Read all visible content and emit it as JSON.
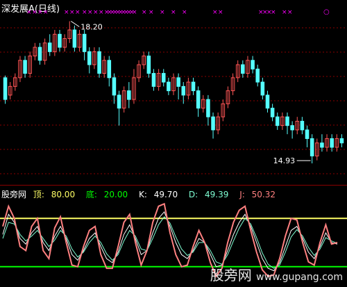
{
  "main": {
    "title": "深发展A(日线)",
    "high_label": "18.20",
    "low_label": "14.93",
    "colors": {
      "up": "#ff5555",
      "down": "#55ffff",
      "marker": "#ff00ff",
      "grid": "#8b0000"
    }
  },
  "indicator": {
    "name": "股旁网",
    "top_label": "顶:",
    "top_value": "80.00",
    "bottom_label": "底:",
    "bottom_value": "20.00",
    "k_label": "K:",
    "k_value": "49.70",
    "d_label": "D:",
    "d_value": "49.39",
    "j_label": "J:",
    "j_value": "50.32",
    "colors": {
      "top": "#ffff66",
      "bottom": "#00ff00",
      "k": "#ffffff",
      "d": "#7fffd4",
      "j": "#ff8080"
    }
  },
  "watermark": {
    "cn": "股旁网",
    "url": "www.gupang.com"
  },
  "chart_data": [
    {
      "type": "candlestick",
      "title": "深发展A(日线)",
      "ylim": [
        14.5,
        18.4
      ],
      "annotations": [
        {
          "text": "18.20",
          "value": 18.2
        },
        {
          "text": "14.93",
          "value": 14.93
        }
      ],
      "candles": [
        [
          16.9,
          16.4,
          16.95,
          16.3
        ],
        [
          16.5,
          16.7,
          16.8,
          16.4
        ],
        [
          16.7,
          16.9,
          17.0,
          16.6
        ],
        [
          16.9,
          17.3,
          17.4,
          16.8
        ],
        [
          17.3,
          17.0,
          17.4,
          16.9
        ],
        [
          17.0,
          17.4,
          17.5,
          16.9
        ],
        [
          17.4,
          17.6,
          17.7,
          17.3
        ],
        [
          17.6,
          17.3,
          17.7,
          17.2
        ],
        [
          17.3,
          17.7,
          17.8,
          17.2
        ],
        [
          17.7,
          17.5,
          17.9,
          17.4
        ],
        [
          17.5,
          17.9,
          18.0,
          17.4
        ],
        [
          17.9,
          17.6,
          18.0,
          17.5
        ],
        [
          17.6,
          17.8,
          17.9,
          17.5
        ],
        [
          17.8,
          18.0,
          18.2,
          17.7
        ],
        [
          18.0,
          17.6,
          18.1,
          17.5
        ],
        [
          17.6,
          17.9,
          18.0,
          17.5
        ],
        [
          17.9,
          17.5,
          18.0,
          17.3
        ],
        [
          17.5,
          17.2,
          17.6,
          17.0
        ],
        [
          17.2,
          17.5,
          17.6,
          17.1
        ],
        [
          17.5,
          17.0,
          17.6,
          16.9
        ],
        [
          17.0,
          17.3,
          17.4,
          16.9
        ],
        [
          17.3,
          16.9,
          17.4,
          16.7
        ],
        [
          16.9,
          16.5,
          17.0,
          16.3
        ],
        [
          16.5,
          16.2,
          16.6,
          15.8
        ],
        [
          16.2,
          16.6,
          16.7,
          16.1
        ],
        [
          16.6,
          16.4,
          16.8,
          16.2
        ],
        [
          16.4,
          16.9,
          17.1,
          16.3
        ],
        [
          16.9,
          17.2,
          17.3,
          16.8
        ],
        [
          17.2,
          17.4,
          17.5,
          17.1
        ],
        [
          17.4,
          17.0,
          17.5,
          16.9
        ],
        [
          17.0,
          16.7,
          17.1,
          16.6
        ],
        [
          16.7,
          17.0,
          17.1,
          16.6
        ],
        [
          17.0,
          16.8,
          17.1,
          16.7
        ],
        [
          16.8,
          16.6,
          16.9,
          16.5
        ],
        [
          16.6,
          16.9,
          17.0,
          16.5
        ],
        [
          16.9,
          16.7,
          17.0,
          16.4
        ],
        [
          16.7,
          16.5,
          16.8,
          16.3
        ],
        [
          16.5,
          16.8,
          16.9,
          16.4
        ],
        [
          16.8,
          16.6,
          16.9,
          16.5
        ],
        [
          16.6,
          16.2,
          16.7,
          16.0
        ],
        [
          16.2,
          16.4,
          16.5,
          16.1
        ],
        [
          16.4,
          16.0,
          16.5,
          15.8
        ],
        [
          16.0,
          15.7,
          16.1,
          15.5
        ],
        [
          15.7,
          16.0,
          16.1,
          15.6
        ],
        [
          16.0,
          16.3,
          16.4,
          15.9
        ],
        [
          16.3,
          16.6,
          16.7,
          16.2
        ],
        [
          16.6,
          16.9,
          17.0,
          16.5
        ],
        [
          16.9,
          17.2,
          17.3,
          16.8
        ],
        [
          17.2,
          17.0,
          17.3,
          16.9
        ],
        [
          17.0,
          17.3,
          17.4,
          16.9
        ],
        [
          17.3,
          17.1,
          17.4,
          17.0
        ],
        [
          17.1,
          16.8,
          17.2,
          16.7
        ],
        [
          16.8,
          16.5,
          16.9,
          16.4
        ],
        [
          16.5,
          16.2,
          16.6,
          16.1
        ],
        [
          16.2,
          16.0,
          16.3,
          15.9
        ],
        [
          16.0,
          15.8,
          16.1,
          15.7
        ],
        [
          15.8,
          16.0,
          16.1,
          15.7
        ],
        [
          16.0,
          15.8,
          16.1,
          15.6
        ],
        [
          15.8,
          15.7,
          15.9,
          15.5
        ],
        [
          15.7,
          15.9,
          16.0,
          15.6
        ],
        [
          15.9,
          15.7,
          16.0,
          15.6
        ],
        [
          15.7,
          15.5,
          15.8,
          15.3
        ],
        [
          15.5,
          15.1,
          15.6,
          14.93
        ],
        [
          15.1,
          15.4,
          15.5,
          15.0
        ],
        [
          15.4,
          15.3,
          15.6,
          15.2
        ],
        [
          15.3,
          15.5,
          15.6,
          15.2
        ],
        [
          15.5,
          15.3,
          15.6,
          15.2
        ],
        [
          15.3,
          15.5,
          15.6,
          15.2
        ],
        [
          15.5,
          15.4,
          15.6,
          15.3
        ]
      ]
    },
    {
      "type": "line",
      "series": [
        {
          "name": "K",
          "values": [
            60,
            85,
            75,
            55,
            48,
            62,
            70,
            50,
            40,
            58,
            70,
            55,
            35,
            28,
            40,
            55,
            62,
            45,
            30,
            25,
            38,
            60,
            72,
            55,
            35,
            40,
            62,
            80,
            88,
            70,
            50,
            35,
            30,
            40,
            55,
            50,
            35,
            20,
            22,
            40,
            60,
            75,
            85,
            70,
            50,
            30,
            18,
            15,
            25,
            45,
            65,
            70,
            55,
            38,
            30,
            45,
            62,
            50,
            48
          ]
        },
        {
          "name": "D",
          "values": [
            55,
            75,
            73,
            60,
            52,
            58,
            65,
            55,
            45,
            53,
            65,
            58,
            42,
            32,
            38,
            50,
            58,
            50,
            36,
            28,
            35,
            52,
            65,
            58,
            42,
            40,
            55,
            72,
            82,
            74,
            57,
            42,
            34,
            38,
            50,
            50,
            40,
            26,
            23,
            35,
            52,
            68,
            80,
            73,
            56,
            37,
            23,
            18,
            22,
            38,
            57,
            66,
            58,
            44,
            34,
            42,
            56,
            52,
            49
          ]
        },
        {
          "name": "J",
          "values": [
            70,
            95,
            80,
            45,
            40,
            70,
            80,
            40,
            30,
            68,
            82,
            50,
            22,
            20,
            45,
            65,
            70,
            35,
            18,
            18,
            45,
            75,
            85,
            50,
            22,
            40,
            75,
            95,
            98,
            62,
            35,
            20,
            22,
            45,
            65,
            50,
            25,
            8,
            18,
            50,
            75,
            90,
            95,
            65,
            38,
            16,
            8,
            10,
            30,
            58,
            80,
            78,
            50,
            26,
            22,
            50,
            72,
            48,
            50
          ]
        }
      ],
      "reference_lines": [
        {
          "label": "顶",
          "value": 80
        },
        {
          "label": "底",
          "value": 20
        }
      ],
      "ylim": [
        0,
        100
      ]
    }
  ]
}
